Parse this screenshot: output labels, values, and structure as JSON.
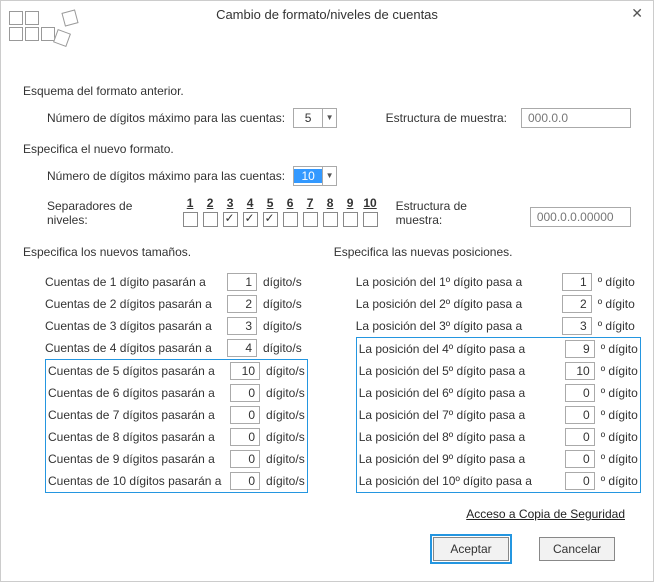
{
  "title": "Cambio de formato/niveles de cuentas",
  "section_prev": "Esquema del formato anterior.",
  "label_max_digits": "Número de dígitos máximo para las cuentas:",
  "prev_max": "5",
  "label_struct": "Estructura de muestra:",
  "prev_struct": "000.0.0",
  "section_new": "Especifica el nuevo formato.",
  "new_max": "10",
  "sep_label": "Separadores de niveles:",
  "sep_nums": [
    "1",
    "2",
    "3",
    "4",
    "5",
    "6",
    "7",
    "8",
    "9",
    "10"
  ],
  "sep_checked": [
    false,
    false,
    true,
    true,
    true,
    false,
    false,
    false,
    false,
    false
  ],
  "new_struct": "000.0.0.00000",
  "col_sizes_head": "Especifica los nuevos tamaños.",
  "col_pos_head": "Especifica las nuevas posiciones.",
  "sizes": [
    {
      "lab": "Cuentas de 1 dígito pasarán a",
      "val": "1",
      "unit": "dígito/s"
    },
    {
      "lab": "Cuentas de 2 dígitos pasarán a",
      "val": "2",
      "unit": "dígito/s"
    },
    {
      "lab": "Cuentas de 3 dígitos pasarán a",
      "val": "3",
      "unit": "dígito/s"
    },
    {
      "lab": "Cuentas de 4 dígitos pasarán a",
      "val": "4",
      "unit": "dígito/s"
    },
    {
      "lab": "Cuentas de 5 dígitos pasarán a",
      "val": "10",
      "unit": "dígito/s"
    },
    {
      "lab": "Cuentas de 6 dígitos pasarán a",
      "val": "0",
      "unit": "dígito/s"
    },
    {
      "lab": "Cuentas de 7 dígitos pasarán a",
      "val": "0",
      "unit": "dígito/s"
    },
    {
      "lab": "Cuentas de 8 dígitos pasarán a",
      "val": "0",
      "unit": "dígito/s"
    },
    {
      "lab": "Cuentas de 9 dígitos pasarán a",
      "val": "0",
      "unit": "dígito/s"
    },
    {
      "lab": "Cuentas de 10 dígitos pasarán a",
      "val": "0",
      "unit": "dígito/s"
    }
  ],
  "positions": [
    {
      "lab": "La posición del 1º dígito pasa a",
      "val": "1",
      "unit": "º dígito"
    },
    {
      "lab": "La posición del 2º dígito pasa a",
      "val": "2",
      "unit": "º dígito"
    },
    {
      "lab": "La posición del 3º dígito pasa a",
      "val": "3",
      "unit": "º dígito"
    },
    {
      "lab": "La posición del 4º dígito pasa a",
      "val": "9",
      "unit": "º dígito"
    },
    {
      "lab": "La posición del 5º dígito pasa a",
      "val": "10",
      "unit": "º dígito"
    },
    {
      "lab": "La posición del 6º dígito pasa a",
      "val": "0",
      "unit": "º dígito"
    },
    {
      "lab": "La posición del 7º dígito pasa a",
      "val": "0",
      "unit": "º dígito"
    },
    {
      "lab": "La posición del 8º dígito pasa a",
      "val": "0",
      "unit": "º dígito"
    },
    {
      "lab": "La posición del 9º dígito pasa a",
      "val": "0",
      "unit": "º dígito"
    },
    {
      "lab": "La posición del 10º dígito pasa a",
      "val": "0",
      "unit": "º dígito"
    }
  ],
  "link_backup": "Acceso a Copia de Seguridad",
  "btn_accept": "Aceptar",
  "btn_cancel": "Cancelar"
}
